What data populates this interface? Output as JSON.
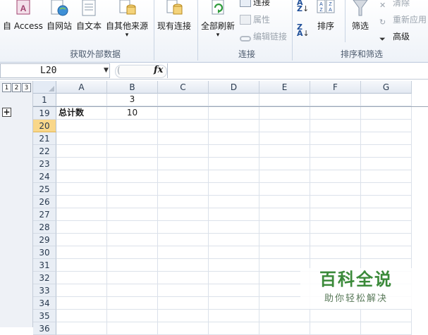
{
  "ribbon": {
    "get_external": {
      "buttons": [
        "自 Access",
        "自网站",
        "自文本",
        "自其他来源"
      ],
      "more_arrow": "▾",
      "group_label": "获取外部数据"
    },
    "existing_connections": "现有连接",
    "connections": {
      "refresh_all": "全部刷新",
      "refresh_arrow": "▾",
      "connect": "连接",
      "properties": "属性",
      "edit_links": "编辑链接",
      "group_label": "连接"
    },
    "sort_filter": {
      "sort": "排序",
      "filter": "筛选",
      "clear": "清除",
      "reapply": "重新应用",
      "advanced": "高级",
      "group_label": "排序和筛选"
    }
  },
  "formula_bar": {
    "name_box": "L20",
    "fx": "fx",
    "content": ""
  },
  "outline": {
    "levels": [
      "1",
      "2",
      "3"
    ],
    "expand": "+"
  },
  "columns": [
    "A",
    "B",
    "C",
    "D",
    "E",
    "F",
    "G"
  ],
  "rows": [
    {
      "num": "1",
      "a": "",
      "b": "3"
    },
    {
      "num": "19",
      "a": "总计数",
      "b": "10"
    },
    {
      "num": "20",
      "a": "",
      "b": ""
    },
    {
      "num": "21",
      "a": "",
      "b": ""
    },
    {
      "num": "22",
      "a": "",
      "b": ""
    },
    {
      "num": "23",
      "a": "",
      "b": ""
    },
    {
      "num": "24",
      "a": "",
      "b": ""
    },
    {
      "num": "25",
      "a": "",
      "b": ""
    },
    {
      "num": "26",
      "a": "",
      "b": ""
    },
    {
      "num": "27",
      "a": "",
      "b": ""
    },
    {
      "num": "28",
      "a": "",
      "b": ""
    },
    {
      "num": "29",
      "a": "",
      "b": ""
    },
    {
      "num": "30",
      "a": "",
      "b": ""
    },
    {
      "num": "31",
      "a": "",
      "b": ""
    },
    {
      "num": "32",
      "a": "",
      "b": ""
    },
    {
      "num": "33",
      "a": "",
      "b": ""
    },
    {
      "num": "34",
      "a": "",
      "b": ""
    },
    {
      "num": "35",
      "a": "",
      "b": ""
    },
    {
      "num": "36",
      "a": "",
      "b": ""
    }
  ],
  "active_row": "20",
  "watermark": {
    "title": "百科全说",
    "subtitle": "助你轻松解决"
  },
  "colors": {
    "accent_green": "#3b8a3a",
    "active_row_header": "#f9d78a",
    "header_blue": "#e4ebf5"
  }
}
